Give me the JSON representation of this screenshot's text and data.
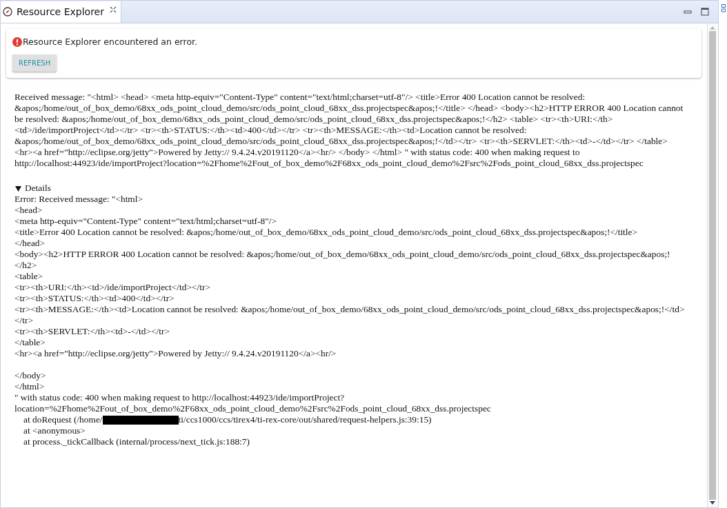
{
  "tab": {
    "title": "Resource Explorer"
  },
  "error_card": {
    "message": "Resource Explorer encountered an error.",
    "button": "REFRESH"
  },
  "message_lines": [
    "Received message: \"<html> <head> <meta http-equiv=\"Content-Type\" content=\"text/html;charset=utf-8\"/> <title>Error 400 Location cannot be resolved:",
    "&apos;/home/out_of_box_demo/68xx_ods_point_cloud_demo/src/ods_point_cloud_68xx_dss.projectspec&apos;!</title> </head> <body><h2>HTTP ERROR 400 Location cannot",
    "be resolved: &apos;/home/out_of_box_demo/68xx_ods_point_cloud_demo/src/ods_point_cloud_68xx_dss.projectspec&apos;!</h2> <table> <tr><th>URI:</th>",
    "<td>/ide/importProject</td></tr> <tr><th>STATUS:</th><td>400</td></tr> <tr><th>MESSAGE:</th><td>Location cannot be resolved:",
    "&apos;/home/out_of_box_demo/68xx_ods_point_cloud_demo/src/ods_point_cloud_68xx_dss.projectspec&apos;!</td></tr> <tr><th>SERVLET:</th><td>-</td></tr> </table>",
    "<hr><a href=\"http://eclipse.org/jetty\">Powered by Jetty:// 9.4.24.v20191120</a><hr/> </body> </html> \" with status code: 400 when making request to",
    "http://localhost:44923/ide/importProject?location=%2Fhome%2Fout_of_box_demo%2F68xx_ods_point_cloud_demo%2Fsrc%2Fods_point_cloud_68xx_dss.projectspec"
  ],
  "details": {
    "label": "Details",
    "expanded": true,
    "lines": [
      {
        "kind": "text",
        "text": "Error: Received message: \"<html>"
      },
      {
        "kind": "text",
        "text": "<head>"
      },
      {
        "kind": "text",
        "text": "<meta http-equiv=\"Content-Type\" content=\"text/html;charset=utf-8\"/>"
      },
      {
        "kind": "text",
        "text": "<title>Error 400 Location cannot be resolved: &apos;/home/out_of_box_demo/68xx_ods_point_cloud_demo/src/ods_point_cloud_68xx_dss.projectspec&apos;!</title>"
      },
      {
        "kind": "text",
        "text": "</head>"
      },
      {
        "kind": "text",
        "text": "<body><h2>HTTP ERROR 400 Location cannot be resolved: &apos;/home/out_of_box_demo/68xx_ods_point_cloud_demo/src/ods_point_cloud_68xx_dss.projectspec&apos;!"
      },
      {
        "kind": "text",
        "text": "</h2>"
      },
      {
        "kind": "text",
        "text": "<table>"
      },
      {
        "kind": "text",
        "text": "<tr><th>URI:</th><td>/ide/importProject</td></tr>"
      },
      {
        "kind": "text",
        "text": "<tr><th>STATUS:</th><td>400</td></tr>"
      },
      {
        "kind": "text",
        "text": "<tr><th>MESSAGE:</th><td>Location cannot be resolved: &apos;/home/out_of_box_demo/68xx_ods_point_cloud_demo/src/ods_point_cloud_68xx_dss.projectspec&apos;!</td>"
      },
      {
        "kind": "text",
        "text": "</tr>"
      },
      {
        "kind": "text",
        "text": "<tr><th>SERVLET:</th><td>-</td></tr>"
      },
      {
        "kind": "text",
        "text": "</table>"
      },
      {
        "kind": "text",
        "text": "<hr><a href=\"http://eclipse.org/jetty\">Powered by Jetty:// 9.4.24.v20191120</a><hr/>"
      },
      {
        "kind": "blank"
      },
      {
        "kind": "text",
        "text": "</body>"
      },
      {
        "kind": "text",
        "text": "</html>"
      },
      {
        "kind": "text",
        "text": "\" with status code: 400 when making request to http://localhost:44923/ide/importProject?"
      },
      {
        "kind": "text",
        "text": "location=%2Fhome%2Fout_of_box_demo%2F68xx_ods_point_cloud_demo%2Fsrc%2Fods_point_cloud_68xx_dss.projectspec"
      },
      {
        "kind": "redacted",
        "before": "at doRequest (/home/",
        "after": "ti/ccs1000/ccs/tirex4/ti-rex-core/out/shared/request-helpers.js:39:15)"
      },
      {
        "kind": "stack",
        "text": "at <anonymous>"
      },
      {
        "kind": "stack",
        "text": "at process._tickCallback (internal/process/next_tick.js:188:7)"
      }
    ]
  }
}
